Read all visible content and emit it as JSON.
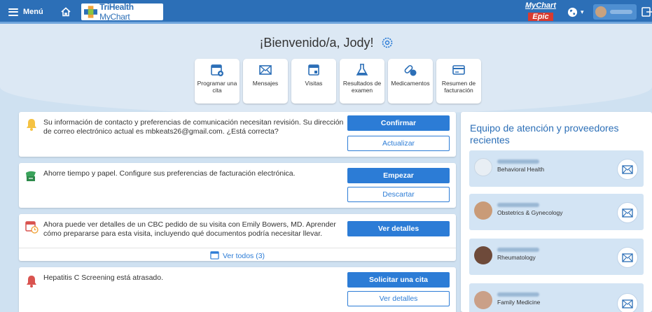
{
  "header": {
    "menu_label": "Menú",
    "brand_name_bold": "TriHealth",
    "brand_name_light": " MyChart",
    "epic_logo_top": "MyChart",
    "epic_logo_bottom": "Epic"
  },
  "welcome": "¡Bienvenido/a, Jody!",
  "quick_actions": [
    {
      "label": "Programar una cita",
      "icon": "calendar-plus-icon"
    },
    {
      "label": "Mensajes",
      "icon": "envelope-icon"
    },
    {
      "label": "Visitas",
      "icon": "calendar-icon"
    },
    {
      "label": "Resultados de examen",
      "icon": "flask-icon"
    },
    {
      "label": "Medicamentos",
      "icon": "pill-icon"
    },
    {
      "label": "Resumen de facturación",
      "icon": "credit-card-icon"
    }
  ],
  "cards": {
    "contact": {
      "message": "Su información de contacto y preferencias de comunicación necesitan revisión. Su dirección de correo electrónico actual es mbkeats26@gmail.com. ¿Está correcta?",
      "primary": "Confirmar",
      "secondary": "Actualizar"
    },
    "billing": {
      "message": "Ahorre tiempo y papel. Configure sus preferencias de facturación electrónica.",
      "primary": "Empezar",
      "secondary": "Descartar"
    },
    "visit": {
      "message": "Ahora puede ver detalles de un CBC pedido de su visita con Emily Bowers, MD. Aprender cómo prepararse para esta visita, incluyendo qué documentos podría necesitar llevar.",
      "primary": "Ver detalles",
      "view_all": "Ver todos (3)"
    },
    "screening": {
      "message": "Hepatitis C Screening está atrasado.",
      "primary": "Solicitar una cita",
      "secondary": "Ver detalles"
    }
  },
  "care_team": {
    "title": "Equipo de atención y proveedores recientes",
    "providers": [
      {
        "specialty": "Behavioral Health"
      },
      {
        "specialty": "Obstetrics & Gynecology"
      },
      {
        "specialty": "Rheumatology"
      },
      {
        "specialty": "Family Medicine"
      }
    ]
  },
  "colors": {
    "primary_blue": "#2c7cd6",
    "header_blue": "#2c6fb7",
    "warning_yellow": "#f5c242",
    "green": "#3aa35b",
    "alert_red": "#d9534f"
  }
}
